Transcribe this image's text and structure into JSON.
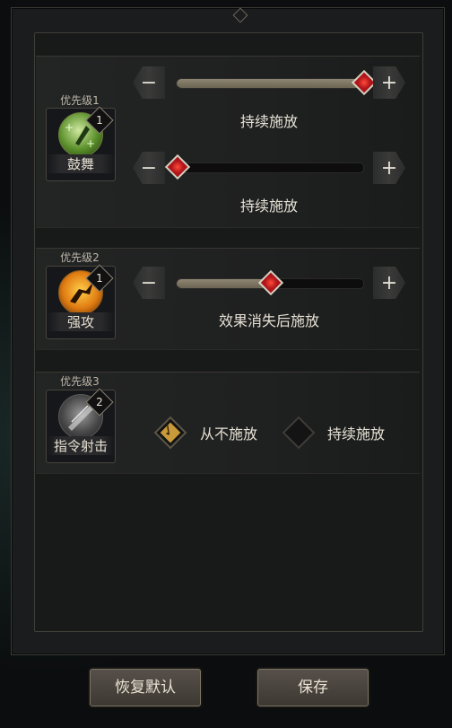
{
  "skills": [
    {
      "priority_label": "优先级1",
      "name": "鼓舞",
      "badge": "1",
      "icon": "inspire-icon",
      "sliders": [
        {
          "mode_label": "持续施放",
          "level": 1.0
        },
        {
          "mode_label": "持续施放",
          "level": 0.0
        }
      ]
    },
    {
      "priority_label": "优先级2",
      "name": "强攻",
      "badge": "1",
      "icon": "assault-icon",
      "sliders": [
        {
          "mode_label": "效果消失后施放",
          "level": 0.5
        }
      ]
    },
    {
      "priority_label": "优先级3",
      "name": "指令射击",
      "badge": "2",
      "icon": "command-shot-icon",
      "options": [
        {
          "label": "从不施放",
          "checked": true
        },
        {
          "label": "持续施放",
          "checked": false
        }
      ]
    }
  ],
  "controls": {
    "minus": "−",
    "plus": "+"
  },
  "footer": {
    "reset_label": "恢复默认",
    "save_label": "保存"
  },
  "colors": {
    "knob": "#d22a2a",
    "checkbox_on": "#c99a3a",
    "slider_fill": "#8e8672"
  }
}
